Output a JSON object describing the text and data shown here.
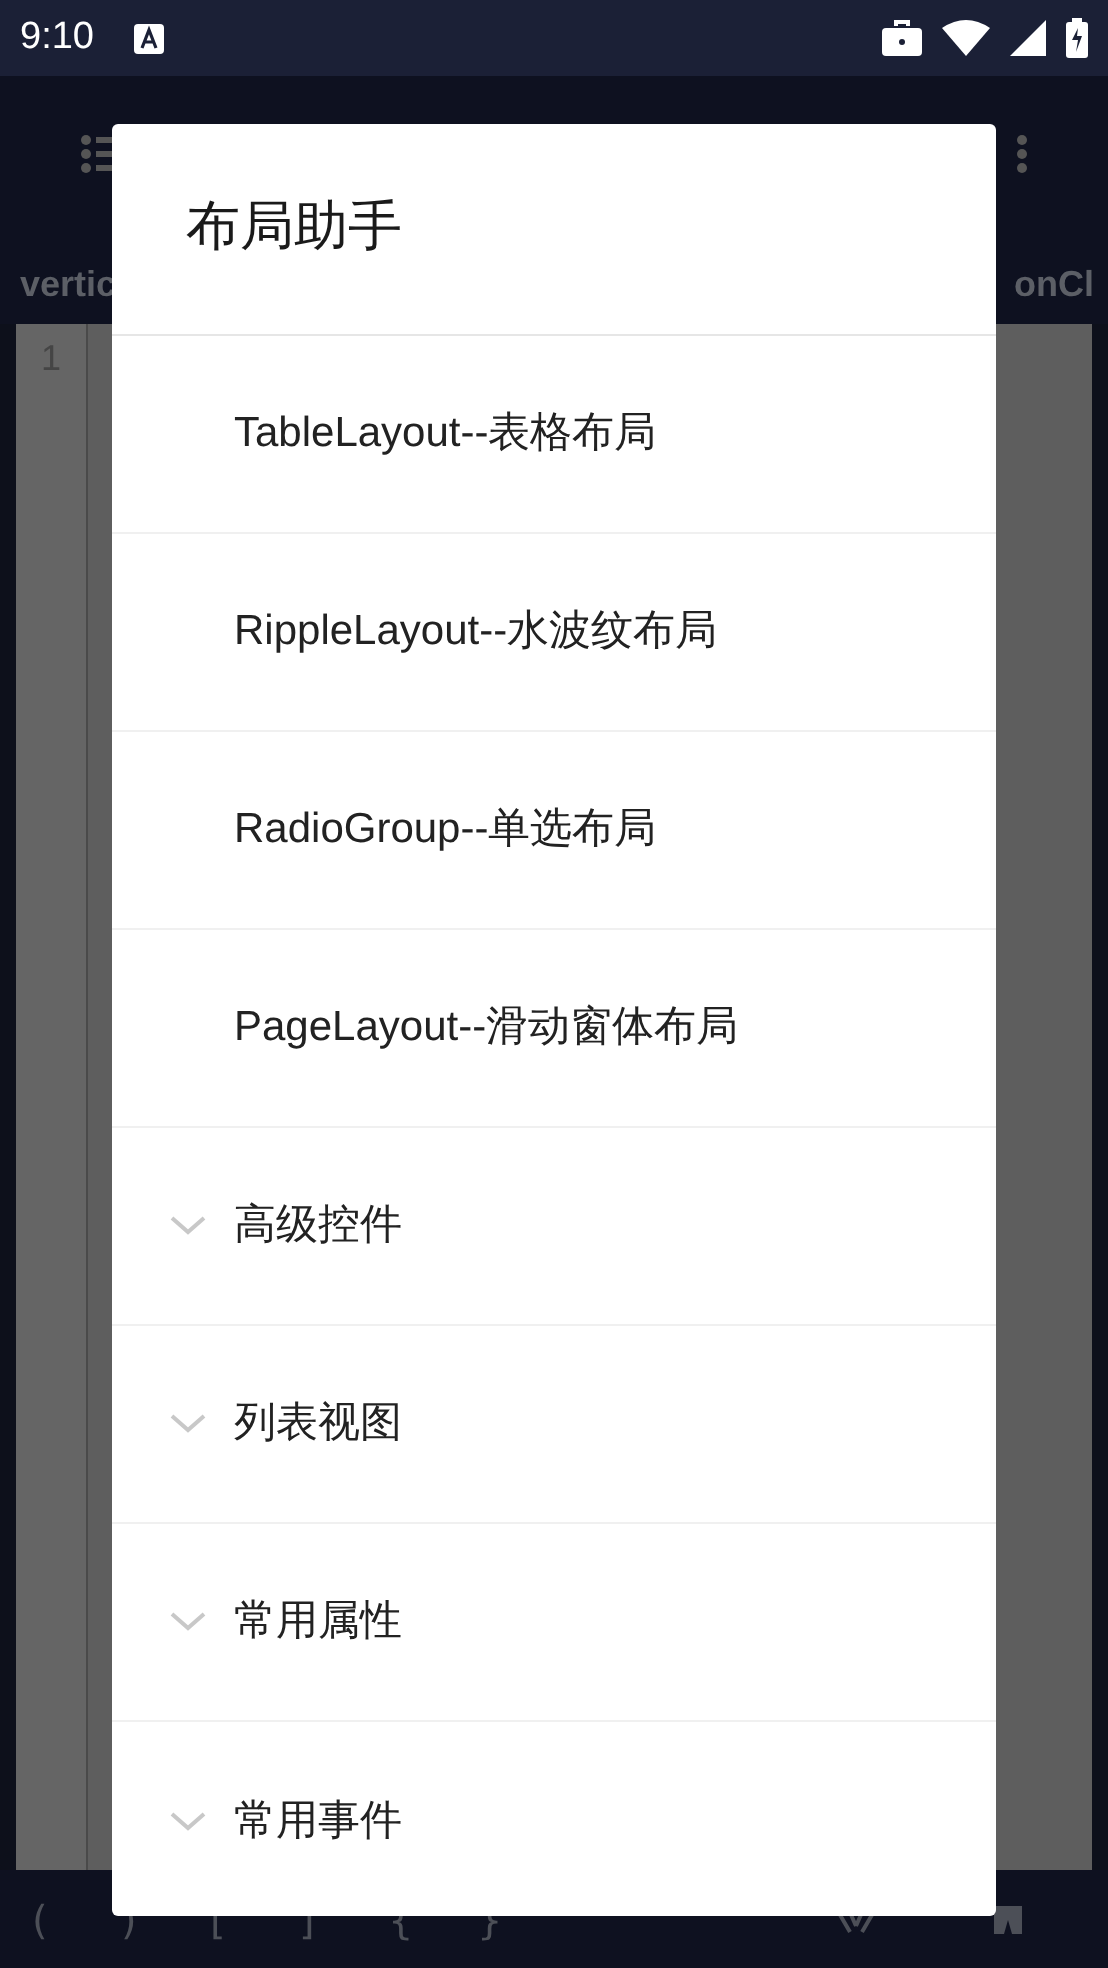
{
  "status_bar": {
    "time": "9:10"
  },
  "background": {
    "tabs": [
      {
        "label": "vertic"
      },
      {
        "label": "onCl"
      }
    ],
    "editor": {
      "line_number": "1"
    },
    "symbols": [
      "(",
      ")",
      "[",
      "]",
      "{",
      "}"
    ]
  },
  "dialog": {
    "title": "布局助手",
    "items": [
      {
        "label": "TableLayout--表格布局",
        "kind": "leaf"
      },
      {
        "label": "RippleLayout--水波纹布局",
        "kind": "leaf"
      },
      {
        "label": "RadioGroup--单选布局",
        "kind": "leaf"
      },
      {
        "label": "PageLayout--滑动窗体布局",
        "kind": "leaf"
      },
      {
        "label": "高级控件",
        "kind": "group",
        "expanded": false
      },
      {
        "label": "列表视图",
        "kind": "group",
        "expanded": false
      },
      {
        "label": "常用属性",
        "kind": "group",
        "expanded": false
      },
      {
        "label": "常用事件",
        "kind": "group",
        "expanded": false
      }
    ]
  }
}
